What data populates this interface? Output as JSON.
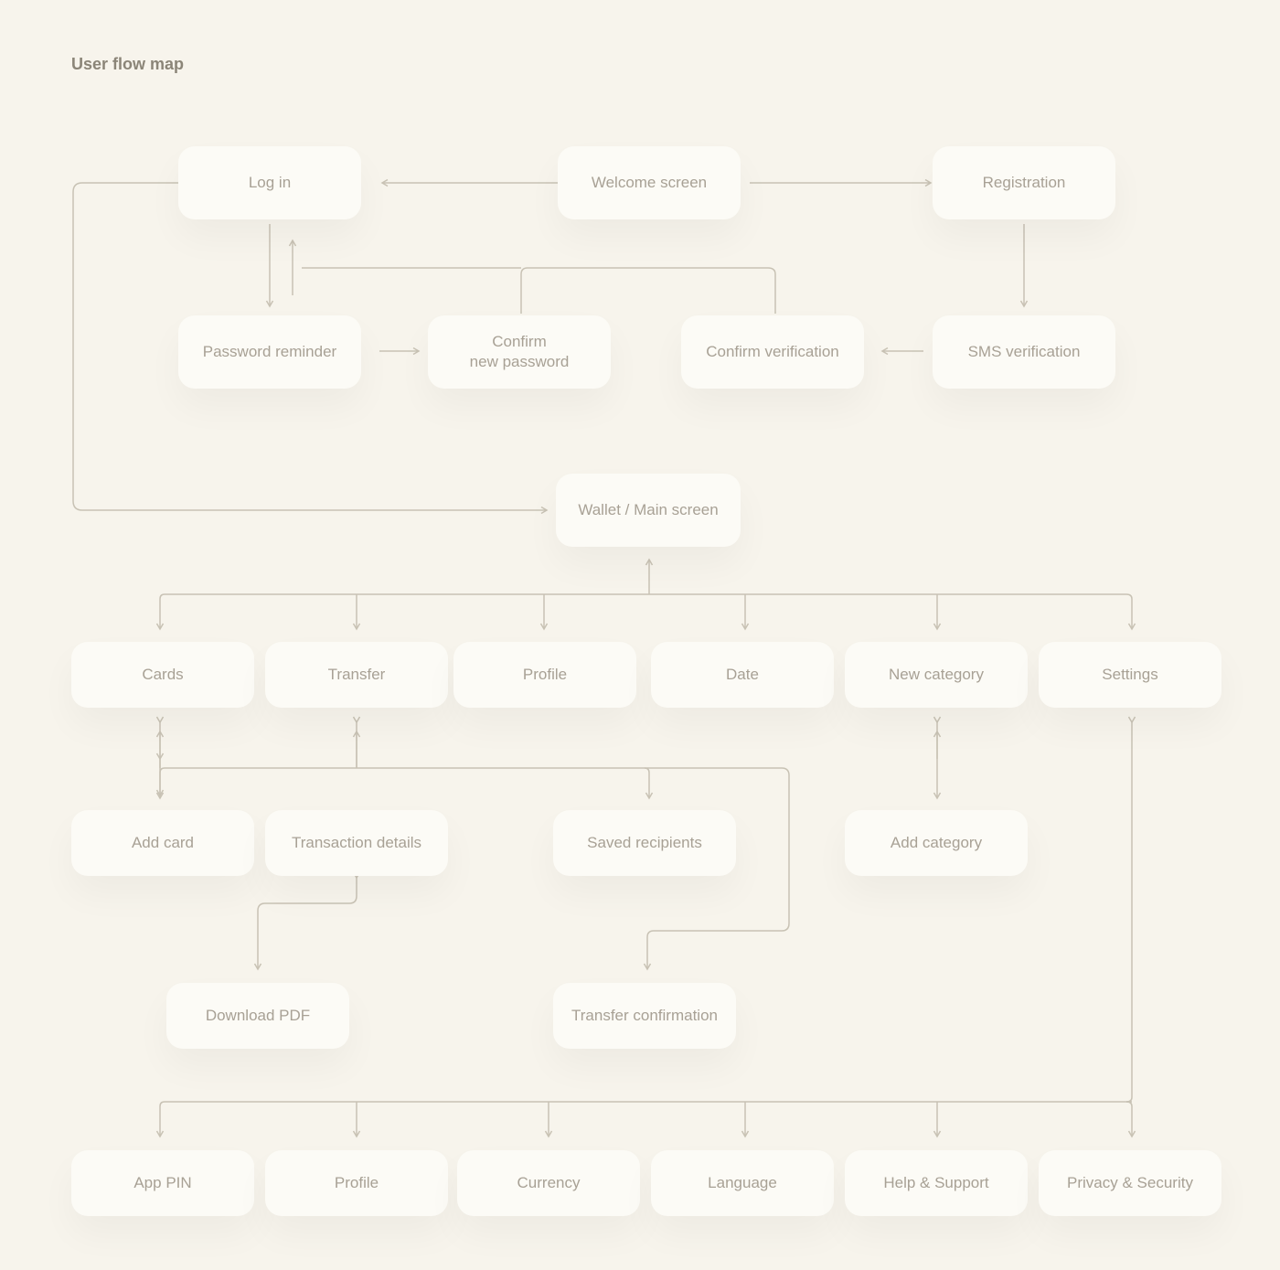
{
  "title": "User flow map",
  "nodes": {
    "login": "Log in",
    "welcome": "Welcome screen",
    "registration": "Registration",
    "password_reminder": "Password reminder",
    "confirm_new_password": "Confirm\nnew password",
    "confirm_verification": "Confirm verification",
    "sms_verification": "SMS verification",
    "wallet_main": "Wallet / Main screen",
    "cards": "Cards",
    "transfer": "Transfer",
    "profile": "Profile",
    "date": "Date",
    "new_category": "New category",
    "settings": "Settings",
    "add_card": "Add card",
    "transaction_details": "Transaction details",
    "saved_recipients": "Saved recipients",
    "add_category": "Add category",
    "download_pdf": "Download PDF",
    "transfer_confirmation": "Transfer confirmation",
    "app_pin": "App PIN",
    "profile2": "Profile",
    "currency": "Currency",
    "language": "Language",
    "help_support": "Help & Support",
    "privacy_security": "Privacy & Security"
  }
}
